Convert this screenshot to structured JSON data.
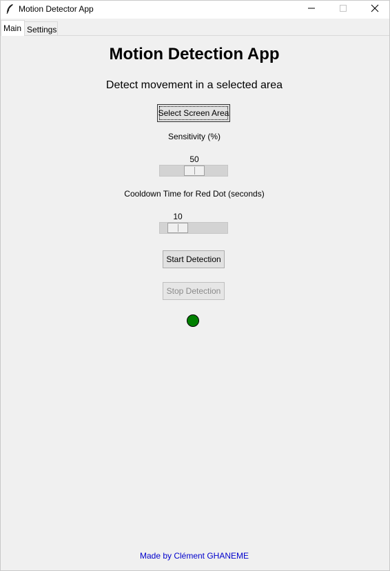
{
  "window": {
    "title": "Motion Detector App",
    "icon": "feather-icon"
  },
  "tabs": [
    {
      "label": "Main",
      "active": true
    },
    {
      "label": "Settings",
      "active": false
    }
  ],
  "main": {
    "heading": "Motion Detection App",
    "subheading": "Detect movement in a selected area",
    "select_button_label": "Select Screen Area",
    "sensitivity": {
      "label": "Sensitivity (%)",
      "value": "50",
      "range": [
        0,
        100
      ]
    },
    "cooldown": {
      "label": "Cooldown Time for Red Dot (seconds)",
      "value": "10",
      "range": [
        0,
        60
      ]
    },
    "start_button_label": "Start Detection",
    "stop_button_label": "Stop Detection",
    "status_dot_color": "#008000"
  },
  "footer": {
    "credit": "Made by Clément GHANEME",
    "color": "#0000cc"
  }
}
